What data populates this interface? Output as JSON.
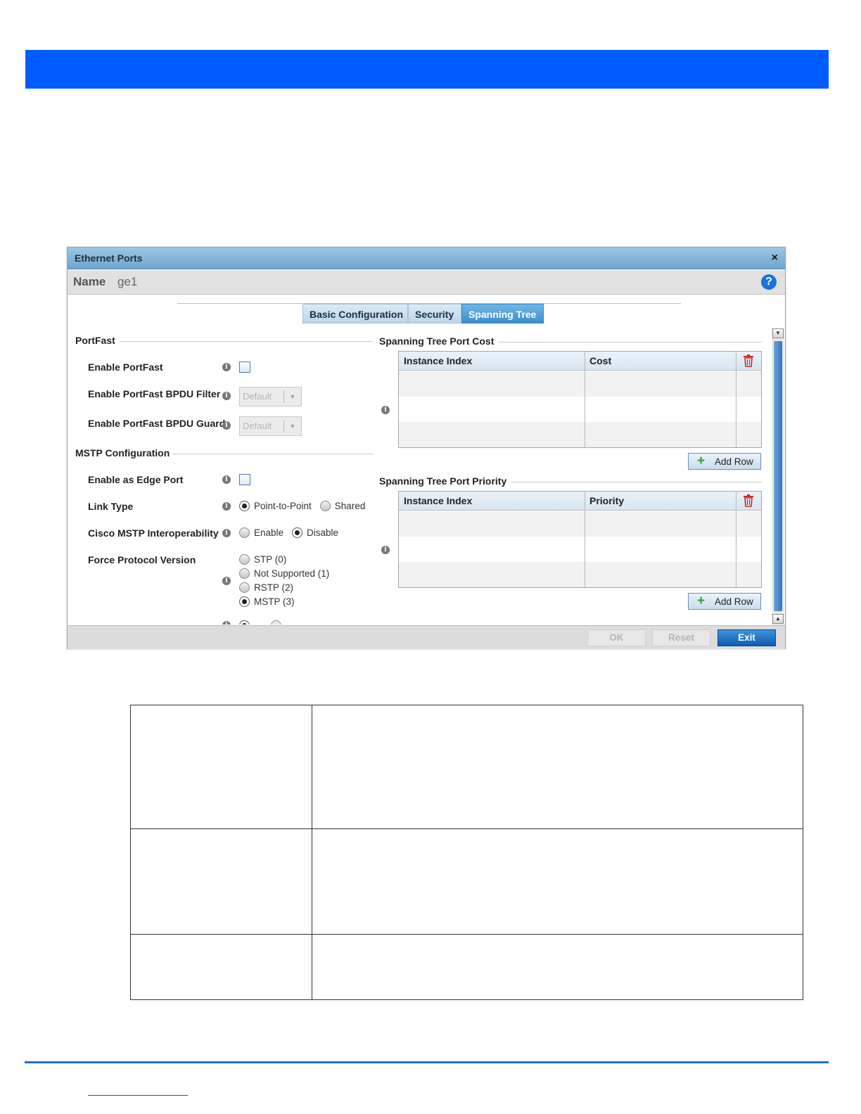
{
  "dialog": {
    "title": "Ethernet Ports",
    "close_symbol": "×",
    "name_label": "Name",
    "name_value": "ge1",
    "help_symbol": "?"
  },
  "tabs": [
    "Basic Configuration",
    "Security",
    "Spanning Tree"
  ],
  "active_tab": "Spanning Tree",
  "portfast": {
    "heading": "PortFast",
    "enable_label": "Enable PortFast",
    "bpdu_filter_label": "Enable PortFast BPDU Filter",
    "bpdu_filter_value": "Default",
    "bpdu_guard_label": "Enable PortFast BPDU Guard",
    "bpdu_guard_value": "Default"
  },
  "mstp": {
    "heading": "MSTP Configuration",
    "edge_port_label": "Enable as Edge Port",
    "link_type_label": "Link Type",
    "link_type_options": [
      "Point-to-Point",
      "Shared"
    ],
    "link_type_selected": "Point-to-Point",
    "cisco_label": "Cisco MSTP Interoperability",
    "cisco_options": [
      "Enable",
      "Disable"
    ],
    "cisco_selected": "Disable",
    "force_label": "Force Protocol Version",
    "force_options": [
      "STP (0)",
      "Not Supported (1)",
      "RSTP (2)",
      "MSTP (3)"
    ],
    "force_selected": "MSTP (3)"
  },
  "cost_table": {
    "heading": "Spanning Tree Port Cost",
    "columns": [
      "Instance Index",
      "Cost"
    ],
    "add_label": "Add Row"
  },
  "priority_table": {
    "heading": "Spanning Tree Port Priority",
    "columns": [
      "Instance Index",
      "Priority"
    ],
    "add_label": "Add Row"
  },
  "footer": {
    "ok": "OK",
    "reset": "Reset",
    "exit": "Exit"
  },
  "icons": {
    "info": "info-icon",
    "trash": "trash-icon",
    "plus": "plus-icon",
    "close": "close-icon",
    "help": "help-icon",
    "dropdown": "chevron-down-icon"
  },
  "colors": {
    "banner": "#005cff",
    "active_tab": "#3c8fcc",
    "exit_button": "#0d5bb0"
  }
}
